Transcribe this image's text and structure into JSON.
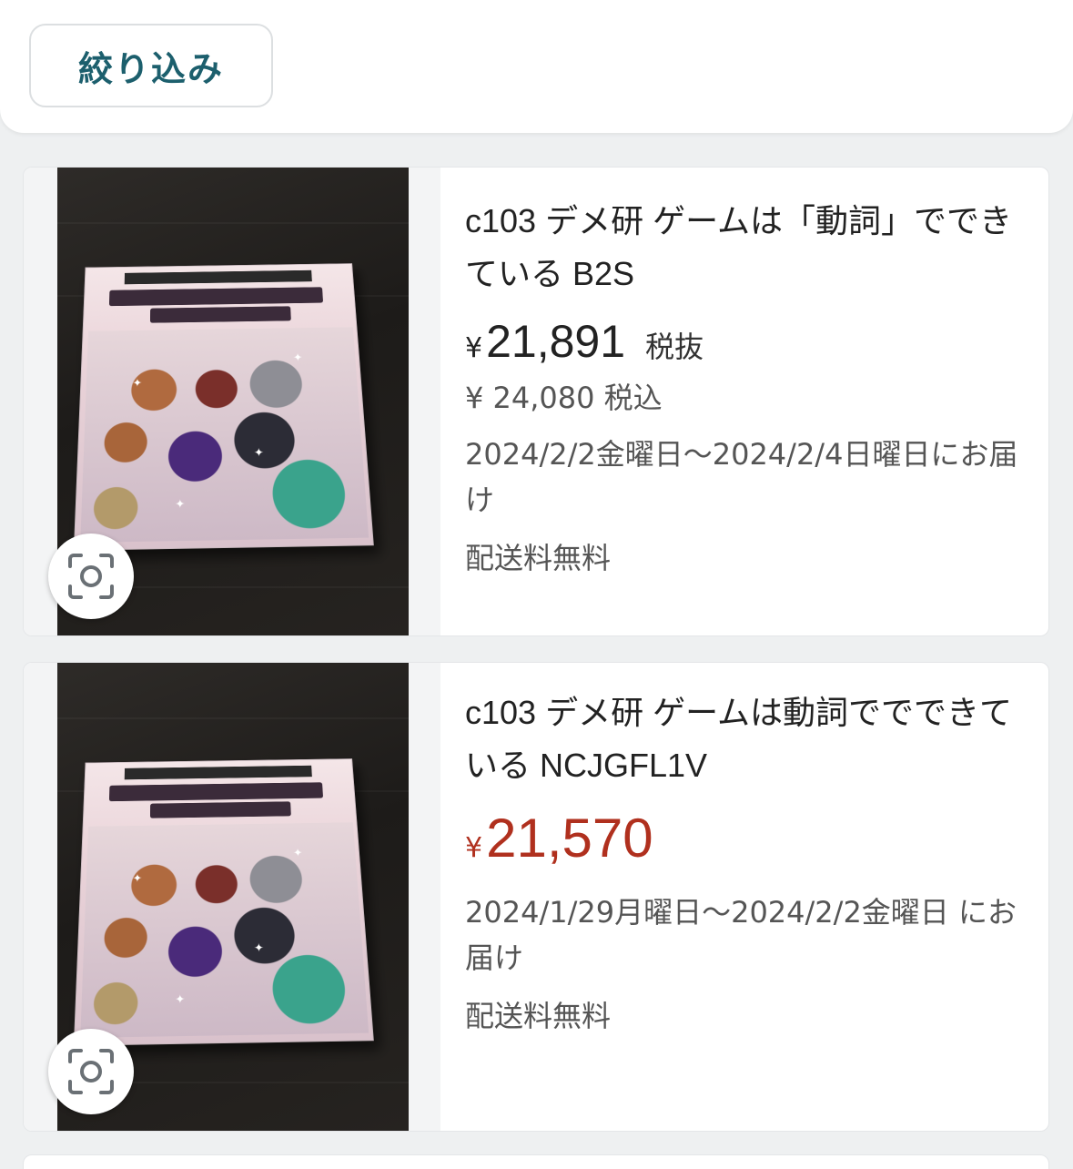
{
  "filter": {
    "label": "絞り込み"
  },
  "products": [
    {
      "title": "c103 デメ研 ゲームは「動詞」でできている B2S",
      "price_symbol": "¥",
      "price": "21,891",
      "price_tax_label": "税抜",
      "price_incl": "¥ 24,080 税込",
      "delivery": "2024/2/2金曜日〜2024/2/4日曜日にお届け",
      "shipping": "配送料無料"
    },
    {
      "title": "c103 デメ研 ゲームは動詞ででできている NCJGFL1V",
      "price_symbol": "¥",
      "price": "21,570",
      "delivery": "2024/1/29月曜日〜2024/2/2金曜日 にお届け",
      "shipping": "配送料無料"
    }
  ],
  "colors": {
    "accent_teal": "#1c5f6d",
    "price_red": "#b0301e"
  },
  "icons": {
    "image_search": "camera-lens-icon"
  }
}
